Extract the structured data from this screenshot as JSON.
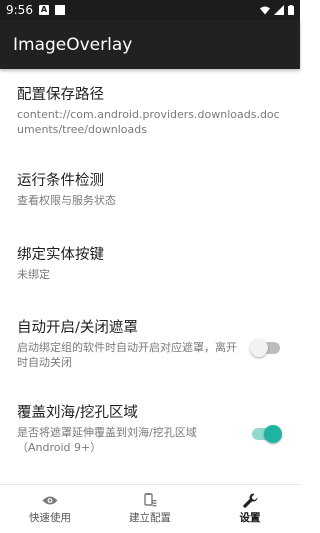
{
  "status_bar": {
    "time": "9:56",
    "icons": [
      "a-badge-icon",
      "square-notification-icon",
      "wifi-icon",
      "signal-icon",
      "battery-icon"
    ]
  },
  "app_bar": {
    "title": "ImageOverlay"
  },
  "settings": {
    "save_path": {
      "title": "配置保存路径",
      "value": "content://com.android.providers.downloads.documents/tree/downloads"
    },
    "runtime_check": {
      "title": "运行条件检测",
      "subtitle": "查看权限与服务状态"
    },
    "bind_key": {
      "title": "绑定实体按键",
      "subtitle": "未绑定"
    },
    "auto_toggle": {
      "title": "自动开启/关闭遮罩",
      "subtitle": "启动绑定组的软件时自动开启对应遮罩，离开时自动关闭",
      "enabled": false
    },
    "cover_notch": {
      "title": "覆盖刘海/挖孔区域",
      "subtitle": "是否将遮罩延伸覆盖到刘海/挖孔区域（Android 9+）",
      "enabled": true
    }
  },
  "bottom_nav": {
    "items": [
      {
        "label": "快速使用",
        "icon": "eye-icon",
        "active": false
      },
      {
        "label": "建立配置",
        "icon": "config-icon",
        "active": false
      },
      {
        "label": "设置",
        "icon": "wrench-icon",
        "active": true
      }
    ]
  },
  "colors": {
    "app_bar": "#212121",
    "status_bar": "#1c1c1c",
    "accent": "#1fb3a2"
  }
}
